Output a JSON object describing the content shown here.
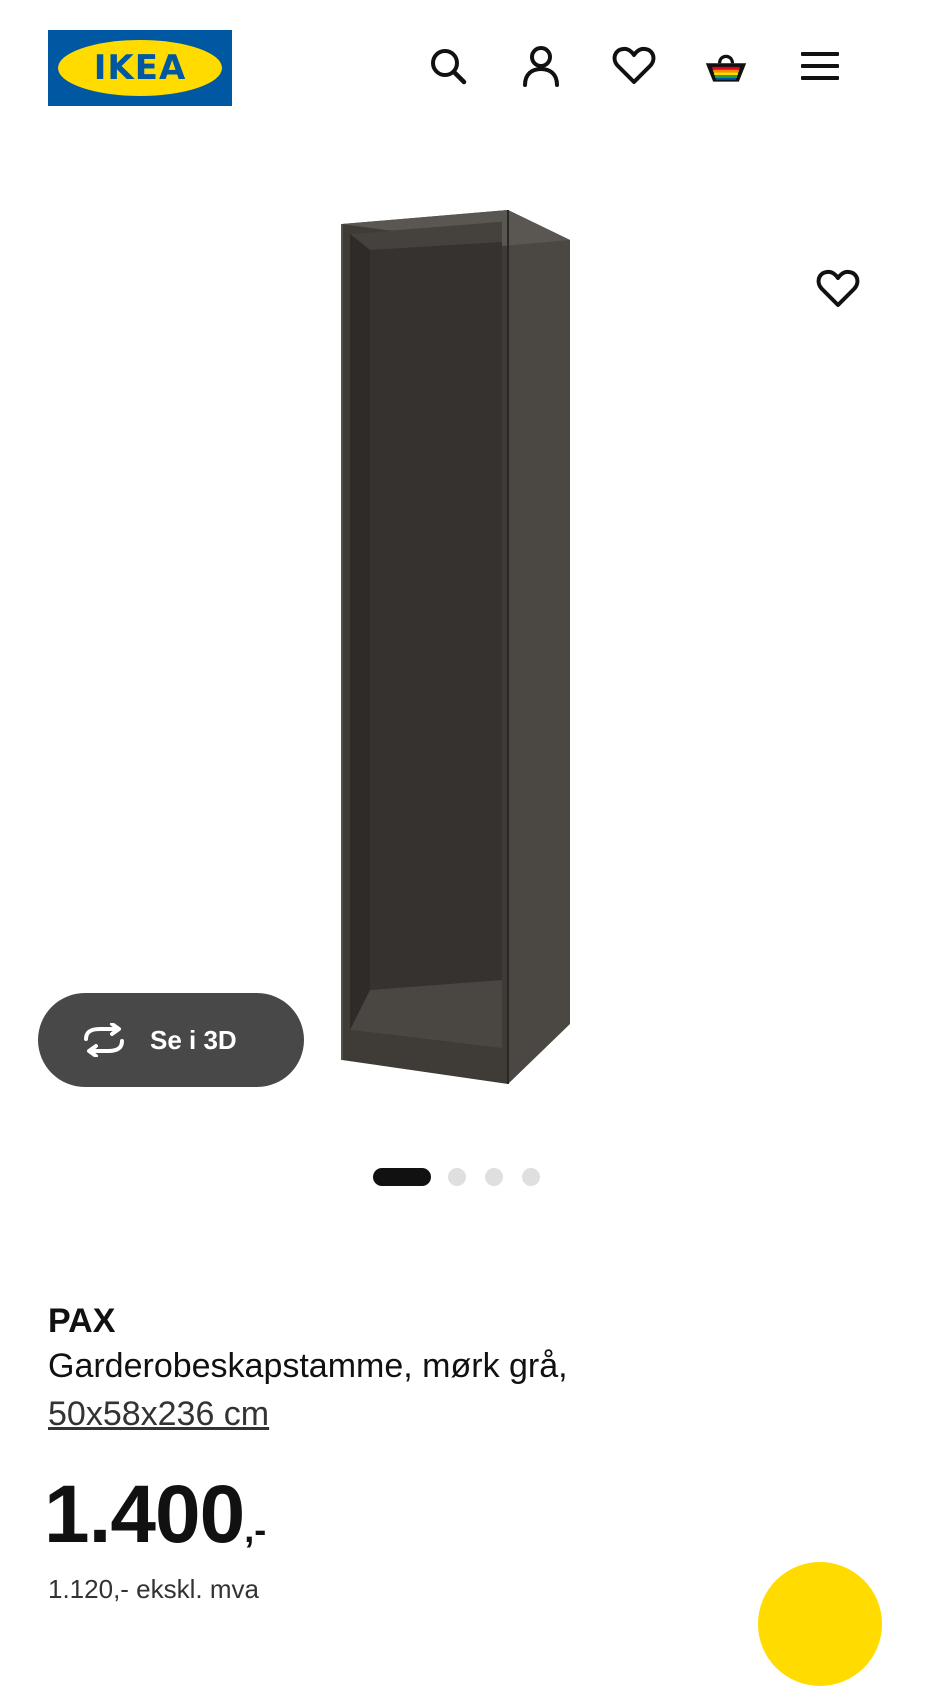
{
  "header": {
    "logo_text": "IKEA",
    "icons": [
      "search-icon",
      "user-icon",
      "heart-icon",
      "basket-icon",
      "menu-icon"
    ]
  },
  "gallery": {
    "view_3d_label": "Se i 3D",
    "slide_count": 4,
    "active_slide": 1
  },
  "product": {
    "name": "PAX",
    "description": "Garderobeskapstamme, mørk grå,",
    "dimensions": "50x58x236 cm",
    "price": "1.400",
    "price_suffix": ",-",
    "price_ex_vat": "1.120,- ekskl. mva"
  },
  "colors": {
    "ikea_blue": "#0058a3",
    "ikea_yellow": "#ffdb00",
    "product_dark_grey": "#3e3a36",
    "button_grey": "#484848"
  }
}
